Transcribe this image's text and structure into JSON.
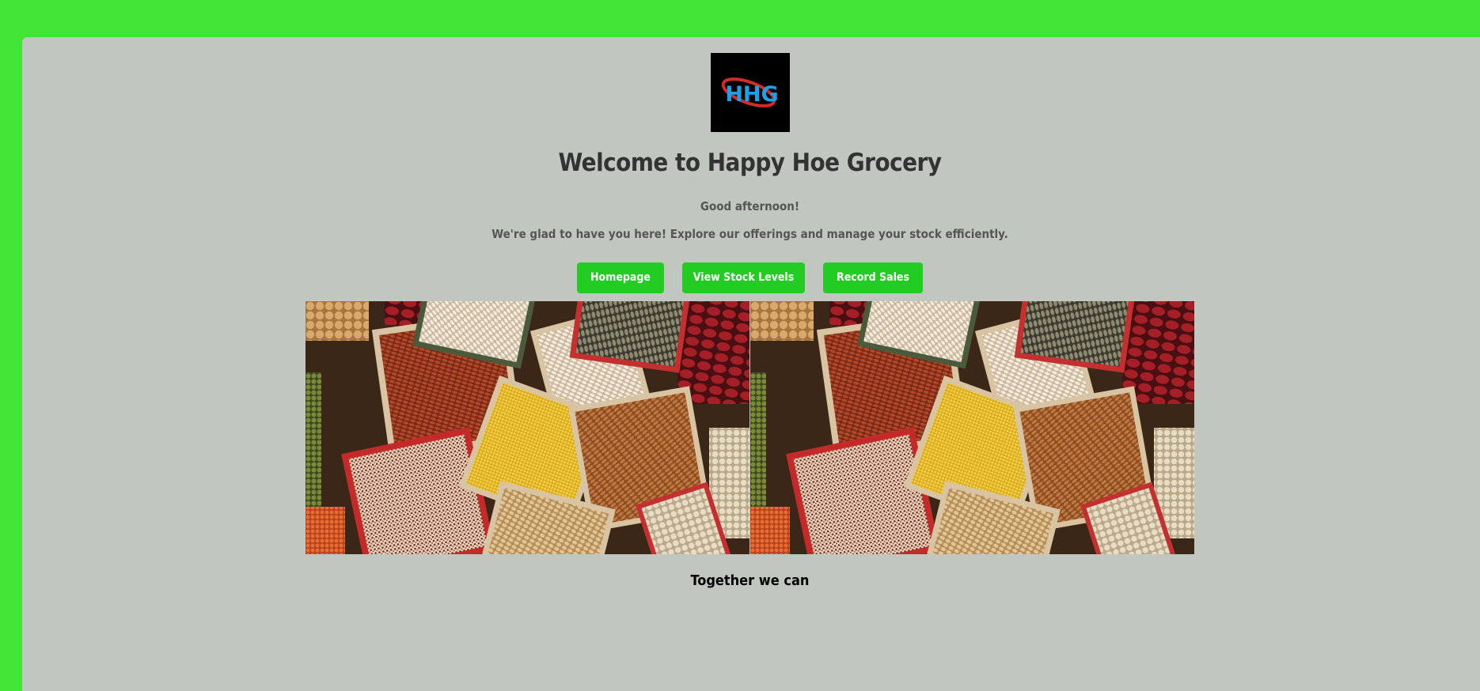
{
  "page": {
    "background_color": "#41e535",
    "card_color": "#c1c6c1"
  },
  "logo": {
    "text": "HHG",
    "icon": "hhg-logo-icon",
    "colors": {
      "background": "#000000",
      "text": "#1da1e6",
      "swoosh": "#d42a2a"
    }
  },
  "header": {
    "title": "Welcome to Happy Hoe Grocery",
    "greeting": "Good afternoon!",
    "subtitle": "We're glad to have you here! Explore our offerings and manage your stock efficiently."
  },
  "nav": {
    "buttons": [
      {
        "label": "Homepage"
      },
      {
        "label": "View Stock Levels"
      },
      {
        "label": "Record Sales"
      }
    ],
    "button_color": "#22cc22"
  },
  "banner": {
    "icon": "grains-and-legumes-image",
    "count": 2
  },
  "footer": {
    "tagline": "Together we can"
  }
}
